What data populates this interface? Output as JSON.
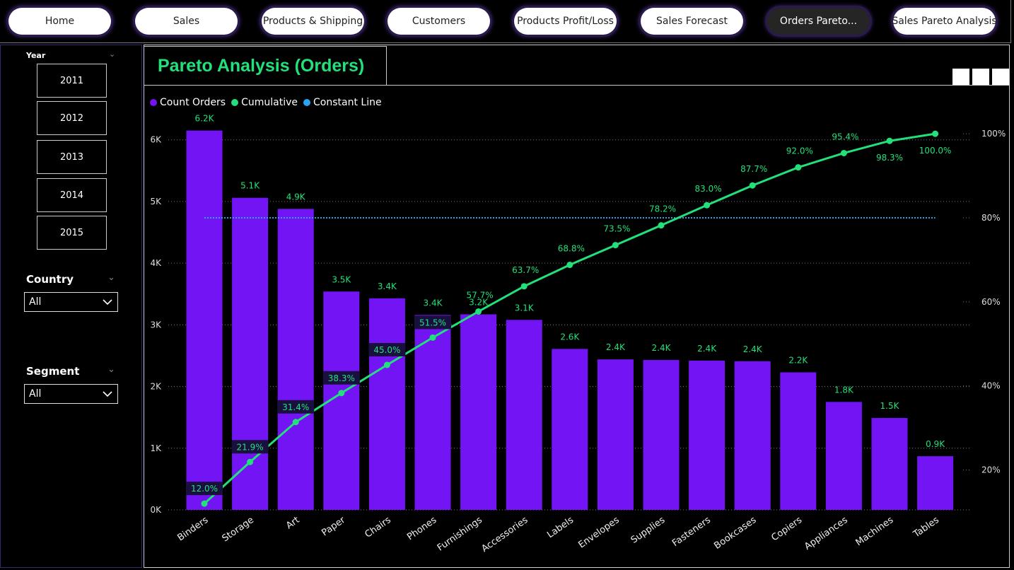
{
  "nav": {
    "buttons": [
      {
        "label": "Home",
        "active": false
      },
      {
        "label": "Sales",
        "active": false
      },
      {
        "label": "Products & Shipping",
        "active": false
      },
      {
        "label": "Customers",
        "active": false
      },
      {
        "label": "Products Profit/Loss",
        "active": false
      },
      {
        "label": "Sales Forecast",
        "active": false
      },
      {
        "label": "Orders Pareto...",
        "active": true
      },
      {
        "label": "Sales Pareto Analysis",
        "active": false
      }
    ]
  },
  "filters": {
    "year": {
      "title": "Year",
      "options": [
        "2011",
        "2012",
        "2013",
        "2014",
        "2015"
      ]
    },
    "country": {
      "title": "Country",
      "value": "All"
    },
    "segment": {
      "title": "Segment",
      "value": "All"
    }
  },
  "chart_title": "Pareto Analysis (Orders)",
  "colors": {
    "bars": "#7314f5",
    "cumulative": "#22e07a",
    "constant": "#2aa3f5"
  },
  "chart_data": {
    "type": "bar",
    "title": "Pareto Analysis (Orders)",
    "legend": [
      "Count Orders",
      "Cumulative",
      "Constant Line"
    ],
    "legend_position": "top-left",
    "categories": [
      "Binders",
      "Storage",
      "Art",
      "Paper",
      "Chairs",
      "Phones",
      "Furnishings",
      "Accessories",
      "Labels",
      "Envelopes",
      "Supplies",
      "Fasteners",
      "Bookcases",
      "Copiers",
      "Appliances",
      "Machines",
      "Tables"
    ],
    "series": [
      {
        "name": "Count Orders",
        "type": "bar",
        "values": [
          6150,
          5060,
          4880,
          3540,
          3430,
          3160,
          3170,
          3080,
          2610,
          2440,
          2430,
          2420,
          2410,
          2230,
          1750,
          1490,
          870
        ],
        "labels": [
          "6.2K",
          "5.1K",
          "4.9K",
          "3.5K",
          "3.4K",
          "3.4K",
          "3.2K",
          "3.1K",
          "2.6K",
          "2.4K",
          "2.4K",
          "2.4K",
          "2.4K",
          "2.2K",
          "1.8K",
          "1.5K",
          "0.9K"
        ]
      },
      {
        "name": "Cumulative",
        "type": "line",
        "axis": "right",
        "values": [
          12.0,
          21.9,
          31.4,
          38.3,
          45.0,
          51.5,
          57.7,
          63.7,
          68.8,
          73.5,
          78.2,
          83.0,
          87.7,
          92.0,
          95.4,
          98.3,
          100.0
        ],
        "labels": [
          "12.0%",
          "21.9%",
          "31.4%",
          "38.3%",
          "45.0%",
          "51.5%",
          "57.7%",
          "63.7%",
          "68.8%",
          "73.5%",
          "78.2%",
          "83.0%",
          "87.7%",
          "92.0%",
          "95.4%",
          "98.3%",
          "100.0%"
        ]
      },
      {
        "name": "Constant Line",
        "type": "line",
        "axis": "right",
        "value": 80
      }
    ],
    "y_left": {
      "ticks": [
        0,
        1000,
        2000,
        3000,
        4000,
        5000,
        6000
      ],
      "tick_labels": [
        "0K",
        "1K",
        "2K",
        "3K",
        "4K",
        "5K",
        "6K"
      ],
      "range": [
        0,
        6180
      ]
    },
    "y_right": {
      "ticks": [
        20,
        40,
        60,
        80,
        100
      ],
      "tick_labels": [
        "20%",
        "40%",
        "60%",
        "80%",
        "100%"
      ],
      "range": [
        10.5,
        101.2
      ]
    },
    "grid": true
  }
}
